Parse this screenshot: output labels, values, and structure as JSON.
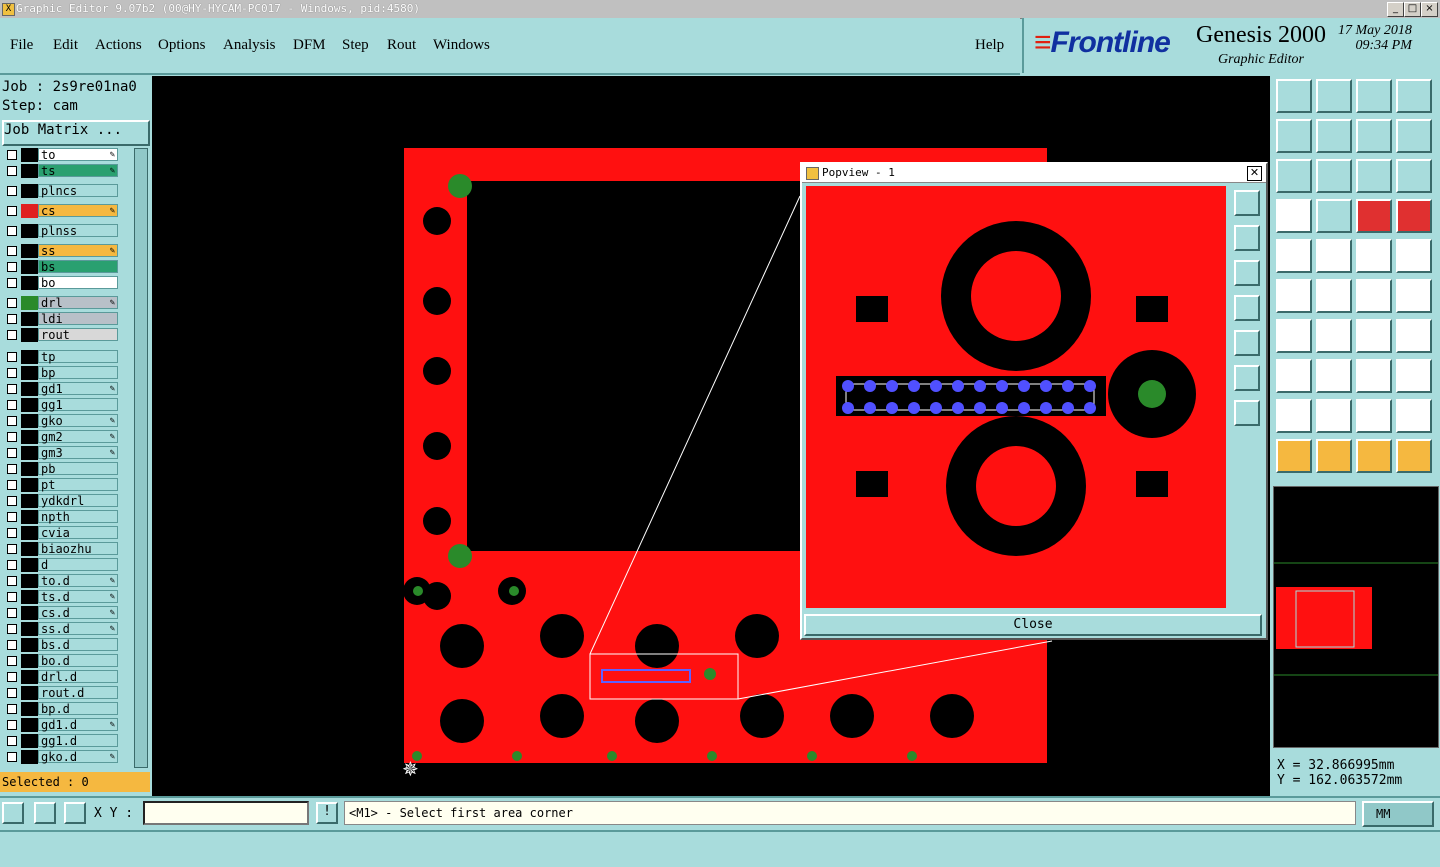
{
  "window": {
    "title": "Graphic Editor 9.07b2 (00@HY-HYCAM-PC017 - Windows, pid:4580)",
    "controls": [
      "_",
      "□",
      "×"
    ]
  },
  "menu": [
    "File",
    "Edit",
    "Actions",
    "Options",
    "Analysis",
    "DFM",
    "Step",
    "Rout",
    "Windows",
    "Help"
  ],
  "brand": {
    "logo": "Frontline",
    "product": "Genesis 2000",
    "subtitle": "Graphic Editor",
    "date": "17 May 2018",
    "time": "09:34 PM"
  },
  "job": {
    "job_line": "Job : 2s9re01na0",
    "step_line": "Step: cam",
    "matrix_button": "Job Matrix ..."
  },
  "layers": [
    {
      "name": "to",
      "color": "#ffffff",
      "swatch": "#000000",
      "edit": true
    },
    {
      "name": "ts",
      "color": "#2aa070",
      "swatch": "#000000",
      "edit": true
    },
    {
      "name": "plncs",
      "color": "#a8dcdc",
      "swatch": "#000000",
      "edit": false
    },
    {
      "name": "cs",
      "color": "#f5b840",
      "swatch": "#e02020",
      "edit": true
    },
    {
      "name": "plnss",
      "color": "#a8dcdc",
      "swatch": "#000000",
      "edit": false
    },
    {
      "name": "ss",
      "color": "#f5b840",
      "swatch": "#000000",
      "edit": true
    },
    {
      "name": "bs",
      "color": "#2aa070",
      "swatch": "#000000",
      "edit": false
    },
    {
      "name": "bo",
      "color": "#ffffff",
      "swatch": "#000000",
      "edit": false
    },
    {
      "name": "drl",
      "color": "#b8c0c8",
      "swatch": "#2a8a2a",
      "edit": true
    },
    {
      "name": "ldi",
      "color": "#b8c0c8",
      "swatch": "#000000",
      "edit": false
    },
    {
      "name": "rout",
      "color": "#d8d8d8",
      "swatch": "#000000",
      "edit": false
    },
    {
      "name": "tp",
      "color": "#a8dcdc",
      "swatch": "#000000",
      "edit": false
    },
    {
      "name": "bp",
      "color": "#a8dcdc",
      "swatch": "#000000",
      "edit": false
    },
    {
      "name": "gd1",
      "color": "#a8dcdc",
      "swatch": "#000000",
      "edit": true
    },
    {
      "name": "gg1",
      "color": "#a8dcdc",
      "swatch": "#000000",
      "edit": false
    },
    {
      "name": "gko",
      "color": "#a8dcdc",
      "swatch": "#000000",
      "edit": true
    },
    {
      "name": "gm2",
      "color": "#a8dcdc",
      "swatch": "#000000",
      "edit": true
    },
    {
      "name": "gm3",
      "color": "#a8dcdc",
      "swatch": "#000000",
      "edit": true
    },
    {
      "name": "pb",
      "color": "#a8dcdc",
      "swatch": "#000000",
      "edit": false
    },
    {
      "name": "pt",
      "color": "#a8dcdc",
      "swatch": "#000000",
      "edit": false
    },
    {
      "name": "ydkdrl",
      "color": "#a8dcdc",
      "swatch": "#000000",
      "edit": false
    },
    {
      "name": "npth",
      "color": "#a8dcdc",
      "swatch": "#000000",
      "edit": false
    },
    {
      "name": "cvia",
      "color": "#a8dcdc",
      "swatch": "#000000",
      "edit": false
    },
    {
      "name": "biaozhu",
      "color": "#a8dcdc",
      "swatch": "#000000",
      "edit": false
    },
    {
      "name": "d",
      "color": "#a8dcdc",
      "swatch": "#000000",
      "edit": false
    },
    {
      "name": "to.d",
      "color": "#a8dcdc",
      "swatch": "#000000",
      "edit": true
    },
    {
      "name": "ts.d",
      "color": "#a8dcdc",
      "swatch": "#000000",
      "edit": true
    },
    {
      "name": "cs.d",
      "color": "#a8dcdc",
      "swatch": "#000000",
      "edit": true
    },
    {
      "name": "ss.d",
      "color": "#a8dcdc",
      "swatch": "#000000",
      "edit": true
    },
    {
      "name": "bs.d",
      "color": "#a8dcdc",
      "swatch": "#000000",
      "edit": false
    },
    {
      "name": "bo.d",
      "color": "#a8dcdc",
      "swatch": "#000000",
      "edit": false
    },
    {
      "name": "drl.d",
      "color": "#a8dcdc",
      "swatch": "#000000",
      "edit": false
    },
    {
      "name": "rout.d",
      "color": "#a8dcdc",
      "swatch": "#000000",
      "edit": false
    },
    {
      "name": "bp.d",
      "color": "#a8dcdc",
      "swatch": "#000000",
      "edit": false
    },
    {
      "name": "gd1.d",
      "color": "#a8dcdc",
      "swatch": "#000000",
      "edit": true
    },
    {
      "name": "gg1.d",
      "color": "#a8dcdc",
      "swatch": "#000000",
      "edit": false
    },
    {
      "name": "gko.d",
      "color": "#a8dcdc",
      "swatch": "#000000",
      "edit": true
    }
  ],
  "selected_text": "Selected : 0",
  "popview": {
    "title": "Popview - 1",
    "close_label": "Close"
  },
  "coords": {
    "x": "X = 32.866995mm",
    "y": "Y = 162.063572mm"
  },
  "bottom": {
    "xy_label": "X Y :",
    "xy_value": "",
    "message": "<M1> - Select first area corner",
    "units": "MM"
  },
  "colors": {
    "board": "#ff1010",
    "panel": "#a8dcdc",
    "pad_green": "#2a8a2a",
    "highlight": "#f5b840"
  }
}
